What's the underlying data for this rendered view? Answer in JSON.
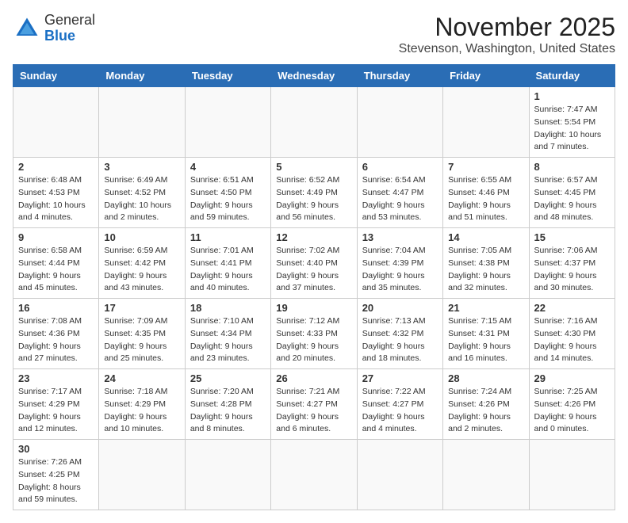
{
  "logo": {
    "line1": "General",
    "line2": "Blue"
  },
  "title": "November 2025",
  "subtitle": "Stevenson, Washington, United States",
  "weekdays": [
    "Sunday",
    "Monday",
    "Tuesday",
    "Wednesday",
    "Thursday",
    "Friday",
    "Saturday"
  ],
  "weeks": [
    [
      {
        "day": "",
        "info": ""
      },
      {
        "day": "",
        "info": ""
      },
      {
        "day": "",
        "info": ""
      },
      {
        "day": "",
        "info": ""
      },
      {
        "day": "",
        "info": ""
      },
      {
        "day": "",
        "info": ""
      },
      {
        "day": "1",
        "info": "Sunrise: 7:47 AM\nSunset: 5:54 PM\nDaylight: 10 hours and 7 minutes."
      }
    ],
    [
      {
        "day": "2",
        "info": "Sunrise: 6:48 AM\nSunset: 4:53 PM\nDaylight: 10 hours and 4 minutes."
      },
      {
        "day": "3",
        "info": "Sunrise: 6:49 AM\nSunset: 4:52 PM\nDaylight: 10 hours and 2 minutes."
      },
      {
        "day": "4",
        "info": "Sunrise: 6:51 AM\nSunset: 4:50 PM\nDaylight: 9 hours and 59 minutes."
      },
      {
        "day": "5",
        "info": "Sunrise: 6:52 AM\nSunset: 4:49 PM\nDaylight: 9 hours and 56 minutes."
      },
      {
        "day": "6",
        "info": "Sunrise: 6:54 AM\nSunset: 4:47 PM\nDaylight: 9 hours and 53 minutes."
      },
      {
        "day": "7",
        "info": "Sunrise: 6:55 AM\nSunset: 4:46 PM\nDaylight: 9 hours and 51 minutes."
      },
      {
        "day": "8",
        "info": "Sunrise: 6:57 AM\nSunset: 4:45 PM\nDaylight: 9 hours and 48 minutes."
      }
    ],
    [
      {
        "day": "9",
        "info": "Sunrise: 6:58 AM\nSunset: 4:44 PM\nDaylight: 9 hours and 45 minutes."
      },
      {
        "day": "10",
        "info": "Sunrise: 6:59 AM\nSunset: 4:42 PM\nDaylight: 9 hours and 43 minutes."
      },
      {
        "day": "11",
        "info": "Sunrise: 7:01 AM\nSunset: 4:41 PM\nDaylight: 9 hours and 40 minutes."
      },
      {
        "day": "12",
        "info": "Sunrise: 7:02 AM\nSunset: 4:40 PM\nDaylight: 9 hours and 37 minutes."
      },
      {
        "day": "13",
        "info": "Sunrise: 7:04 AM\nSunset: 4:39 PM\nDaylight: 9 hours and 35 minutes."
      },
      {
        "day": "14",
        "info": "Sunrise: 7:05 AM\nSunset: 4:38 PM\nDaylight: 9 hours and 32 minutes."
      },
      {
        "day": "15",
        "info": "Sunrise: 7:06 AM\nSunset: 4:37 PM\nDaylight: 9 hours and 30 minutes."
      }
    ],
    [
      {
        "day": "16",
        "info": "Sunrise: 7:08 AM\nSunset: 4:36 PM\nDaylight: 9 hours and 27 minutes."
      },
      {
        "day": "17",
        "info": "Sunrise: 7:09 AM\nSunset: 4:35 PM\nDaylight: 9 hours and 25 minutes."
      },
      {
        "day": "18",
        "info": "Sunrise: 7:10 AM\nSunset: 4:34 PM\nDaylight: 9 hours and 23 minutes."
      },
      {
        "day": "19",
        "info": "Sunrise: 7:12 AM\nSunset: 4:33 PM\nDaylight: 9 hours and 20 minutes."
      },
      {
        "day": "20",
        "info": "Sunrise: 7:13 AM\nSunset: 4:32 PM\nDaylight: 9 hours and 18 minutes."
      },
      {
        "day": "21",
        "info": "Sunrise: 7:15 AM\nSunset: 4:31 PM\nDaylight: 9 hours and 16 minutes."
      },
      {
        "day": "22",
        "info": "Sunrise: 7:16 AM\nSunset: 4:30 PM\nDaylight: 9 hours and 14 minutes."
      }
    ],
    [
      {
        "day": "23",
        "info": "Sunrise: 7:17 AM\nSunset: 4:29 PM\nDaylight: 9 hours and 12 minutes."
      },
      {
        "day": "24",
        "info": "Sunrise: 7:18 AM\nSunset: 4:29 PM\nDaylight: 9 hours and 10 minutes."
      },
      {
        "day": "25",
        "info": "Sunrise: 7:20 AM\nSunset: 4:28 PM\nDaylight: 9 hours and 8 minutes."
      },
      {
        "day": "26",
        "info": "Sunrise: 7:21 AM\nSunset: 4:27 PM\nDaylight: 9 hours and 6 minutes."
      },
      {
        "day": "27",
        "info": "Sunrise: 7:22 AM\nSunset: 4:27 PM\nDaylight: 9 hours and 4 minutes."
      },
      {
        "day": "28",
        "info": "Sunrise: 7:24 AM\nSunset: 4:26 PM\nDaylight: 9 hours and 2 minutes."
      },
      {
        "day": "29",
        "info": "Sunrise: 7:25 AM\nSunset: 4:26 PM\nDaylight: 9 hours and 0 minutes."
      }
    ],
    [
      {
        "day": "30",
        "info": "Sunrise: 7:26 AM\nSunset: 4:25 PM\nDaylight: 8 hours and 59 minutes."
      },
      {
        "day": "",
        "info": ""
      },
      {
        "day": "",
        "info": ""
      },
      {
        "day": "",
        "info": ""
      },
      {
        "day": "",
        "info": ""
      },
      {
        "day": "",
        "info": ""
      },
      {
        "day": "",
        "info": ""
      }
    ]
  ]
}
